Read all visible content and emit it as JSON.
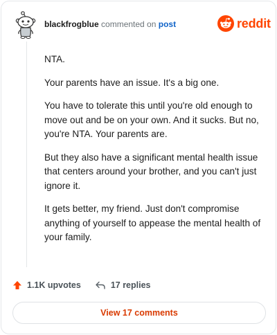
{
  "header": {
    "username": "blackfrogblue",
    "action_text": "commented on",
    "post_link": "post"
  },
  "brand": {
    "name": "reddit",
    "accent": "#ff4500",
    "icon": "reddit-snoo-icon"
  },
  "comment": {
    "paragraphs": [
      "NTA.",
      "Your parents have an issue. It's a big one.",
      "You have to tolerate this until you're old enough to move out and be on your own. And it sucks. But no, you're NTA. Your parents are.",
      "But they also have a significant mental health issue that centers around your brother, and you can't just ignore it.",
      "It gets better, my friend. Just don't compromise anything of yourself to appease the mental health of your family."
    ]
  },
  "actions": {
    "upvotes": "1.1K upvotes",
    "upvote_icon": "upvote-arrow-icon",
    "upvote_color": "#ff4500",
    "replies": "17 replies",
    "reply_icon": "reply-arrow-icon"
  },
  "view_comments": {
    "label": "View 17 comments",
    "color": "#d93a00"
  }
}
